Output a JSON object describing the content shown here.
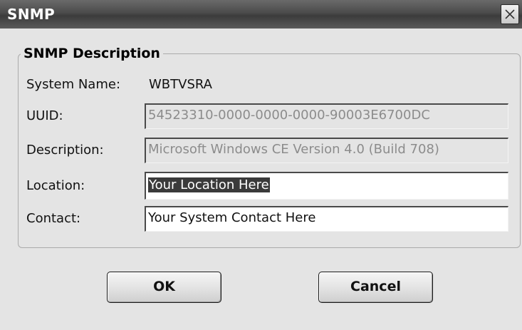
{
  "window": {
    "title": "SNMP",
    "close_icon": "close-icon"
  },
  "group": {
    "title": "SNMP Description"
  },
  "fields": {
    "system_name": {
      "label": "System Name:",
      "value": "WBTVSRA"
    },
    "uuid": {
      "label": "UUID:",
      "value": "54523310-0000-0000-0000-90003E6700DC",
      "enabled": false
    },
    "description": {
      "label": "Description:",
      "value": "Microsoft Windows CE Version 4.0 (Build 708)",
      "enabled": false
    },
    "location": {
      "label": "Location:",
      "value": "Your Location Here",
      "enabled": true,
      "selected": true
    },
    "contact": {
      "label": "Contact:",
      "value": "Your System Contact Here",
      "enabled": true
    }
  },
  "buttons": {
    "ok": "OK",
    "cancel": "Cancel"
  }
}
